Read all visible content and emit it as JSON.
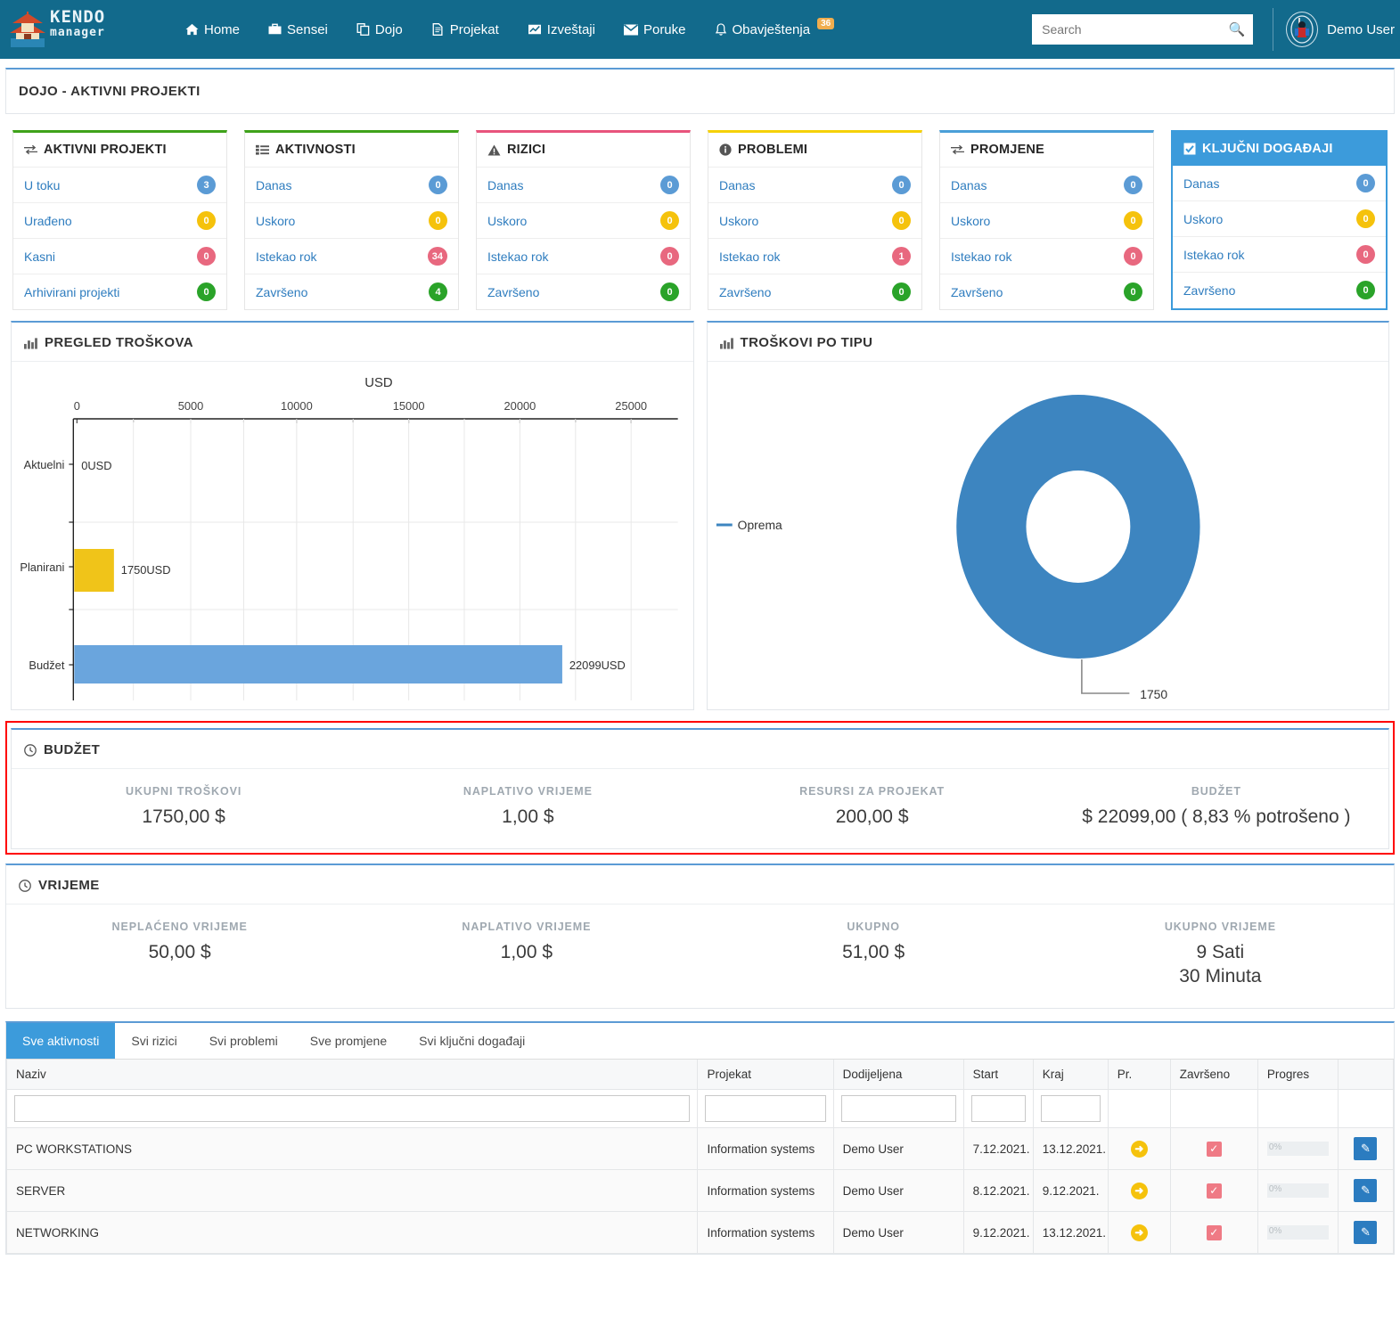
{
  "header": {
    "brand": {
      "line1": "KENDO",
      "line2": "manager"
    },
    "nav": [
      {
        "label": "Home",
        "icon": "home-icon"
      },
      {
        "label": "Sensei",
        "icon": "briefcase-icon"
      },
      {
        "label": "Dojo",
        "icon": "copy-icon"
      },
      {
        "label": "Projekat",
        "icon": "file-icon"
      },
      {
        "label": "Izveštaji",
        "icon": "chart-line-icon"
      },
      {
        "label": "Poruke",
        "icon": "envelope-icon"
      },
      {
        "label": "Obavještenja",
        "icon": "bell-icon",
        "badge": "36"
      }
    ],
    "search": {
      "placeholder": "Search",
      "value": ""
    },
    "user": "Demo User",
    "accent": "#126a8c"
  },
  "page_title": "DOJO - AKTIVNI PROJEKTI",
  "cards": [
    {
      "title": "AKTIVNI PROJEKTI",
      "icon": "exchange-icon",
      "accent": "#3fa21a",
      "selected": false,
      "rows": [
        {
          "label": "U toku",
          "count": "3",
          "color": "blue"
        },
        {
          "label": "Urađeno",
          "count": "0",
          "color": "yellow"
        },
        {
          "label": "Kasni",
          "count": "0",
          "color": "red"
        },
        {
          "label": "Arhivirani projekti",
          "count": "0",
          "color": "green"
        }
      ]
    },
    {
      "title": "AKTIVNOSTI",
      "icon": "tasks-icon",
      "accent": "#3fa21a",
      "selected": false,
      "rows": [
        {
          "label": "Danas",
          "count": "0",
          "color": "blue"
        },
        {
          "label": "Uskoro",
          "count": "0",
          "color": "yellow"
        },
        {
          "label": "Istekao rok",
          "count": "34",
          "color": "red"
        },
        {
          "label": "Završeno",
          "count": "4",
          "color": "green"
        }
      ]
    },
    {
      "title": "RIZICI",
      "icon": "warning-icon",
      "accent": "#e8547c",
      "selected": false,
      "rows": [
        {
          "label": "Danas",
          "count": "0",
          "color": "blue"
        },
        {
          "label": "Uskoro",
          "count": "0",
          "color": "yellow"
        },
        {
          "label": "Istekao rok",
          "count": "0",
          "color": "red"
        },
        {
          "label": "Završeno",
          "count": "0",
          "color": "green"
        }
      ]
    },
    {
      "title": "PROBLEMI",
      "icon": "info-circle-icon",
      "accent": "#f5d108",
      "selected": false,
      "rows": [
        {
          "label": "Danas",
          "count": "0",
          "color": "blue"
        },
        {
          "label": "Uskoro",
          "count": "0",
          "color": "yellow"
        },
        {
          "label": "Istekao rok",
          "count": "1",
          "color": "red"
        },
        {
          "label": "Završeno",
          "count": "0",
          "color": "green"
        }
      ]
    },
    {
      "title": "PROMJENE",
      "icon": "exchange-icon",
      "accent": "#4a9fd8",
      "selected": false,
      "rows": [
        {
          "label": "Danas",
          "count": "0",
          "color": "blue"
        },
        {
          "label": "Uskoro",
          "count": "0",
          "color": "yellow"
        },
        {
          "label": "Istekao rok",
          "count": "0",
          "color": "red"
        },
        {
          "label": "Završeno",
          "count": "0",
          "color": "green"
        }
      ]
    },
    {
      "title": "KLJUČNI DOGAĐAJI",
      "icon": "checkbox-icon",
      "accent": "#3c9bdb",
      "selected": true,
      "rows": [
        {
          "label": "Danas",
          "count": "0",
          "color": "blue"
        },
        {
          "label": "Uskoro",
          "count": "0",
          "color": "yellow"
        },
        {
          "label": "Istekao rok",
          "count": "0",
          "color": "red"
        },
        {
          "label": "Završeno",
          "count": "0",
          "color": "green"
        }
      ]
    }
  ],
  "chart_data": [
    {
      "type": "bar",
      "orientation": "horizontal",
      "panel_title": "PREGLED TROŠKOVA",
      "panel_icon": "bar-chart-icon",
      "title": "USD",
      "xlabel": "USD",
      "ylabel": "",
      "categories": [
        "Aktuelni",
        "Planirani",
        "Budžet"
      ],
      "values": [
        0,
        1750,
        22099
      ],
      "point_labels": [
        "0USD",
        "1750USD",
        "22099USD"
      ],
      "colors": [
        "#5b9bd5",
        "#f0c419",
        "#6aa5dd"
      ],
      "xticks": [
        0,
        5000,
        10000,
        15000,
        20000,
        25000
      ],
      "xtick_labels": [
        "0",
        "5000",
        "10000",
        "15000",
        "20000",
        "25000"
      ],
      "xlim": [
        0,
        27000
      ],
      "grid": true,
      "legend": "none"
    },
    {
      "type": "pie",
      "variant": "donut",
      "panel_title": "TROŠKOVI PO TIPU",
      "panel_icon": "bar-chart-icon",
      "title": "",
      "labels": [
        "Oprema"
      ],
      "values": [
        1750
      ],
      "point_labels": [
        "1750"
      ],
      "colors": [
        "#3d85c0"
      ],
      "legend": "left",
      "legend_entries": [
        "Oprema"
      ]
    }
  ],
  "budget": {
    "title": "BUDŽET",
    "icon": "clock-icon",
    "highlighted": true,
    "highlight_color": "#ff0000",
    "stats": [
      {
        "label": "UKUPNI TROŠKOVI",
        "value": "1750,00 $"
      },
      {
        "label": "NAPLATIVO VRIJEME",
        "value": "1,00 $"
      },
      {
        "label": "RESURSI ZA PROJEKAT",
        "value": "200,00 $"
      },
      {
        "label": "BUDŽET",
        "value": "$ 22099,00 ( 8,83 % potrošeno )"
      }
    ]
  },
  "time": {
    "title": "VRIJEME",
    "icon": "clock-icon",
    "stats": [
      {
        "label": "NEPLAĆENO VRIJEME",
        "value": "50,00 $",
        "value2": ""
      },
      {
        "label": "NAPLATIVO VRIJEME",
        "value": "1,00 $",
        "value2": ""
      },
      {
        "label": "UKUPNO",
        "value": "51,00 $",
        "value2": ""
      },
      {
        "label": "UKUPNO VRIJEME",
        "value": "9 Sati",
        "value2": "30 Minuta"
      }
    ]
  },
  "tabs": [
    {
      "label": "Sve aktivnosti",
      "active": true
    },
    {
      "label": "Svi rizici",
      "active": false
    },
    {
      "label": "Svi problemi",
      "active": false
    },
    {
      "label": "Sve promjene",
      "active": false
    },
    {
      "label": "Svi ključni događaji",
      "active": false
    }
  ],
  "table": {
    "columns": [
      "Naziv",
      "Projekat",
      "Dodijeljena",
      "Start",
      "Kraj",
      "Pr.",
      "Završeno",
      "Progres",
      ""
    ],
    "filters": [
      "",
      "",
      "",
      "",
      "",
      null,
      null,
      null,
      null
    ],
    "rows": [
      {
        "naziv": "PC WORKSTATIONS",
        "projekat": "Information systems",
        "dodijeljena": "Demo User",
        "start": "7.12.2021.",
        "kraj": "13.12.2021.",
        "pr": "arrow-right-icon",
        "zavrseno": "checked",
        "progres": "0%",
        "action": "edit-icon"
      },
      {
        "naziv": "SERVER",
        "projekat": "Information systems",
        "dodijeljena": "Demo User",
        "start": "8.12.2021.",
        "kraj": "9.12.2021.",
        "pr": "arrow-right-icon",
        "zavrseno": "checked",
        "progres": "0%",
        "action": "edit-icon"
      },
      {
        "naziv": "NETWORKING",
        "projekat": "Information systems",
        "dodijeljena": "Demo User",
        "start": "9.12.2021.",
        "kraj": "13.12.2021.",
        "pr": "arrow-right-icon",
        "zavrseno": "checked",
        "progres": "0%",
        "action": "edit-icon"
      }
    ]
  }
}
